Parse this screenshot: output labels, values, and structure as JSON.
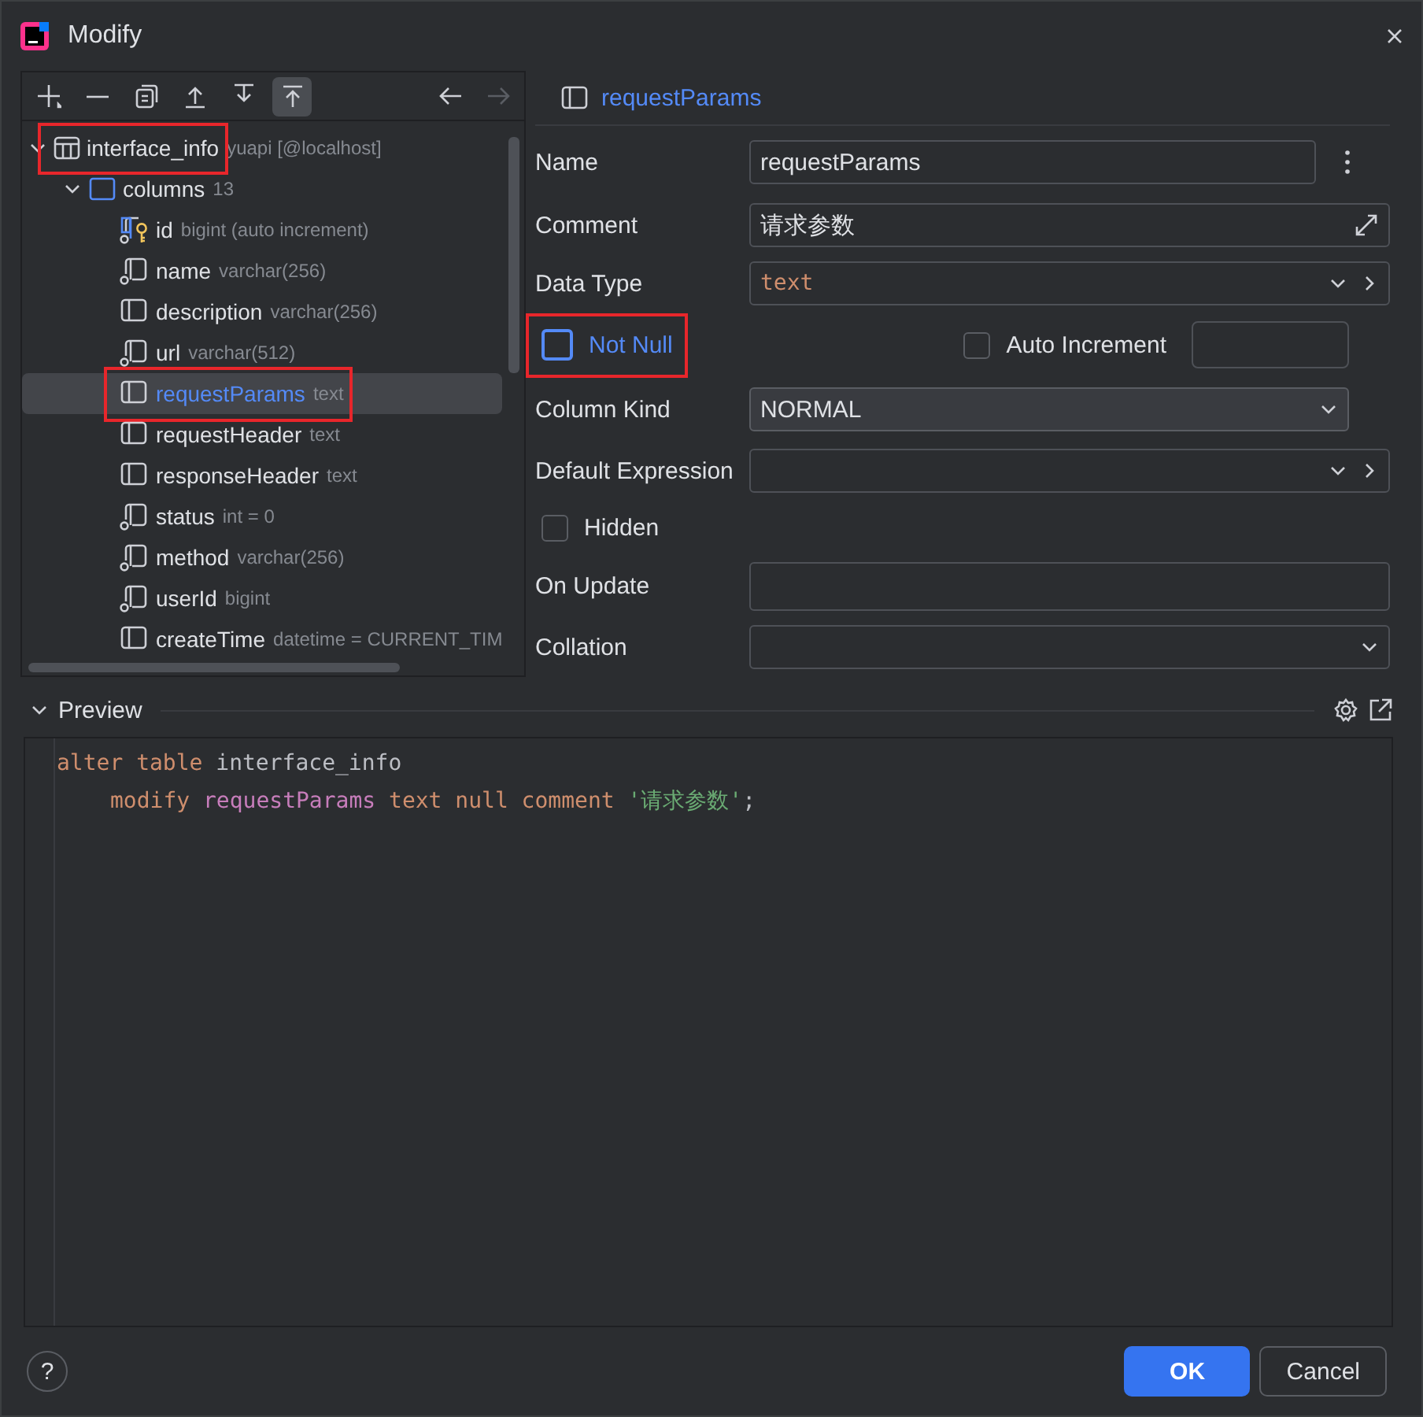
{
  "window": {
    "title": "Modify"
  },
  "toolbar": [
    {
      "kind": "add",
      "on": false,
      "disabled": false
    },
    {
      "kind": "remove",
      "on": false,
      "disabled": false
    },
    {
      "kind": "copy",
      "on": false,
      "disabled": false
    },
    {
      "kind": "up",
      "on": false,
      "disabled": false
    },
    {
      "kind": "down",
      "on": false,
      "disabled": false
    },
    {
      "kind": "top",
      "on": true,
      "disabled": false
    },
    {
      "kind": "back",
      "on": false,
      "disabled": false
    },
    {
      "kind": "forward",
      "on": false,
      "disabled": true
    }
  ],
  "tree": {
    "label": "interface_info",
    "detail": "yuapi [@localhost]",
    "expanded": true,
    "annotated": true,
    "children": [
      {
        "label": "columns",
        "detail": "13",
        "expanded": true,
        "children": [
          {
            "label": "id",
            "detail": "bigint (auto increment)",
            "kind": "key",
            "selected": false,
            "annotated": false
          },
          {
            "label": "name",
            "detail": "varchar(256)",
            "kind": "nullable",
            "selected": false,
            "annotated": false
          },
          {
            "label": "description",
            "detail": "varchar(256)",
            "kind": "plain",
            "selected": false,
            "annotated": false
          },
          {
            "label": "url",
            "detail": "varchar(512)",
            "kind": "nullable",
            "selected": false,
            "annotated": false
          },
          {
            "label": "requestParams",
            "detail": "text",
            "kind": "plain",
            "selected": true,
            "annotated": true
          },
          {
            "label": "requestHeader",
            "detail": "text",
            "kind": "plain",
            "selected": false,
            "annotated": false
          },
          {
            "label": "responseHeader",
            "detail": "text",
            "kind": "plain",
            "selected": false,
            "annotated": false
          },
          {
            "label": "status",
            "detail": "int = 0",
            "kind": "nullable",
            "selected": false,
            "annotated": false
          },
          {
            "label": "method",
            "detail": "varchar(256)",
            "kind": "nullable",
            "selected": false,
            "annotated": false
          },
          {
            "label": "userId",
            "detail": "bigint",
            "kind": "nullable",
            "selected": false,
            "annotated": false
          },
          {
            "label": "createTime",
            "detail": "datetime = CURRENT_TIM",
            "kind": "plain",
            "selected": false,
            "annotated": false
          }
        ]
      }
    ]
  },
  "form": {
    "header": "requestParams",
    "name": {
      "label": "Name",
      "value": "requestParams"
    },
    "comment": {
      "label": "Comment",
      "value": "请求参数"
    },
    "data_type": {
      "label": "Data Type",
      "value": "text"
    },
    "not_null": {
      "label": "Not Null",
      "checked": false,
      "focused": true,
      "annotated": true
    },
    "auto_increment": {
      "label": "Auto Increment",
      "checked": false
    },
    "column_kind": {
      "label": "Column Kind",
      "value": "NORMAL"
    },
    "default_expression": {
      "label": "Default Expression"
    },
    "hidden": {
      "label": "Hidden",
      "checked": false
    },
    "on_update": {
      "label": "On Update"
    },
    "collation": {
      "label": "Collation"
    }
  },
  "preview": {
    "title": "Preview",
    "expanded": true,
    "lines": [
      {
        "indented": false,
        "tokens": [
          {
            "kind": "keyword",
            "text": "alter table"
          },
          {
            "kind": "plain",
            "text": " interface_info"
          }
        ]
      },
      {
        "indented": true,
        "tokens": [
          {
            "kind": "keyword",
            "text": "modify"
          },
          {
            "kind": "column",
            "text": " requestParams"
          },
          {
            "kind": "keyword",
            "text": " text null comment"
          },
          {
            "kind": "string",
            "text": " '请求参数'"
          },
          {
            "kind": "plain",
            "text": ";"
          }
        ]
      }
    ]
  },
  "footer": {
    "help": "?",
    "ok": "OK",
    "cancel": "Cancel"
  }
}
